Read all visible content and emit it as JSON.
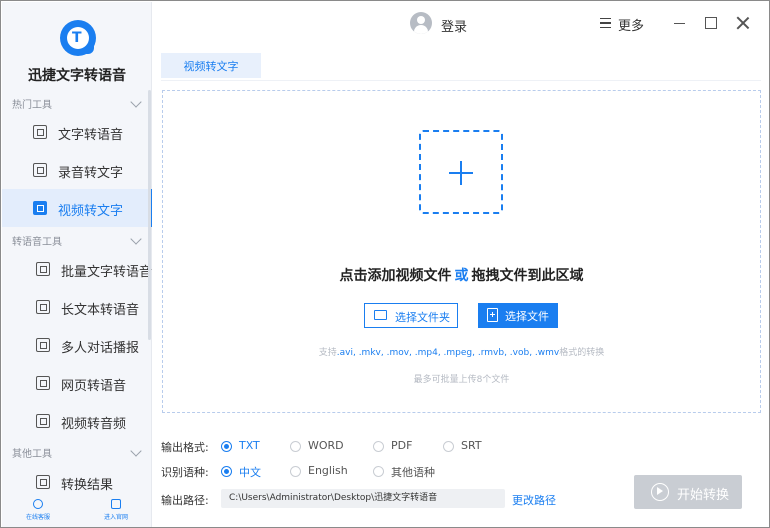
{
  "app": {
    "title": "迅捷文字转语音"
  },
  "sidebar": {
    "groups": [
      {
        "label": "热门工具"
      },
      {
        "label": "转语音工具"
      },
      {
        "label": "其他工具"
      }
    ],
    "hot_items": [
      {
        "label": "文字转语音",
        "icon": "text-to-speech-icon"
      },
      {
        "label": "录音转文字",
        "icon": "recording-to-text-icon"
      },
      {
        "label": "视频转文字",
        "icon": "video-to-text-icon",
        "active": true
      }
    ],
    "tts_items": [
      {
        "label": "批量文字转语音",
        "icon": "batch-text-icon"
      },
      {
        "label": "长文本转语音",
        "icon": "long-text-icon"
      },
      {
        "label": "多人对话播报",
        "icon": "dialogue-icon"
      },
      {
        "label": "网页转语音",
        "icon": "webpage-icon"
      },
      {
        "label": "视频转音频",
        "icon": "video-to-audio-icon"
      }
    ],
    "other_items": [
      {
        "label": "转换结果",
        "icon": "result-icon"
      }
    ],
    "bottom": {
      "service": "在线客服",
      "group": "进入官网"
    }
  },
  "topbar": {
    "login": "登录",
    "more": "更多"
  },
  "tab": {
    "label": "视频转文字"
  },
  "dropzone": {
    "title_left": "点击添加视频文件",
    "title_or": "或",
    "title_right": "拖拽文件到此区域",
    "btn_folder": "选择文件夹",
    "btn_file": "选择文件",
    "formats_prefix": "支持",
    "formats": ".avi, .mkv, .mov, .mp4, .mpeg, .rmvb, .vob, .wmv",
    "formats_suffix": "格式的转换",
    "limit": "最多可批量上传8个文件"
  },
  "settings": {
    "format_label": "输出格式:",
    "formats": [
      "TXT",
      "WORD",
      "PDF",
      "SRT"
    ],
    "format_selected": "TXT",
    "lang_label": "识别语种:",
    "langs": [
      "中文",
      "English",
      "其他语种"
    ],
    "lang_selected": "中文",
    "path_label": "输出路径:",
    "path_value": "C:\\Users\\Administrator\\Desktop\\迅捷文字转语音",
    "change_path": "更改路径",
    "start": "开始转换"
  },
  "colors": {
    "accent": "#1a7ef0",
    "disabled": "#c9cdd3"
  }
}
